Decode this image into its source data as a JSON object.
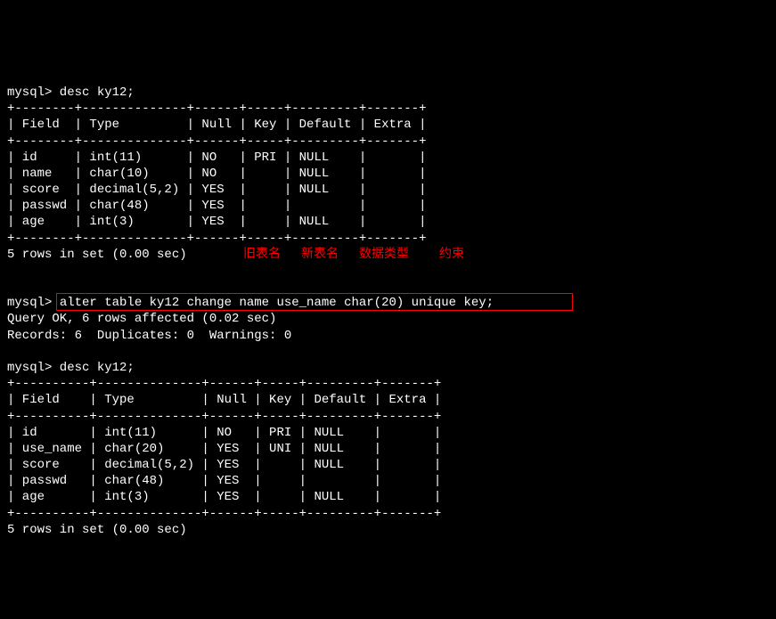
{
  "line1": "mysql> desc ky12;",
  "table1": {
    "sep": "+--------+--------------+------+-----+---------+-------+",
    "header": "| Field  | Type         | Null | Key | Default | Extra |",
    "rows": [
      "| id     | int(11)      | NO   | PRI | NULL    |       |",
      "| name   | char(10)     | NO   |     | NULL    |       |",
      "| score  | decimal(5,2) | YES  |     | NULL    |       |",
      "| passwd | char(48)     | YES  |     |         |       |",
      "| age    | int(3)       | YES  |     | NULL    |       |"
    ]
  },
  "result1": "5 rows in set (0.00 sec)",
  "annotations": {
    "a1": "旧表名",
    "a2": "新表名",
    "a3": "数据类型",
    "a4": "约束"
  },
  "alter_prompt": "mysql> ",
  "alter_cmd": "alter table ky12 change name use_name char(20) unique key;",
  "query_ok": "Query OK, 6 rows affected (0.02 sec)",
  "records": "Records: 6  Duplicates: 0  Warnings: 0",
  "line2": "mysql> desc ky12;",
  "table2": {
    "sep": "+----------+--------------+------+-----+---------+-------+",
    "header": "| Field    | Type         | Null | Key | Default | Extra |",
    "rows": [
      "| id       | int(11)      | NO   | PRI | NULL    |       |",
      "| use_name | char(20)     | YES  | UNI | NULL    |       |",
      "| score    | decimal(5,2) | YES  |     | NULL    |       |",
      "| passwd   | char(48)     | YES  |     |         |       |",
      "| age      | int(3)       | YES  |     | NULL    |       |"
    ]
  },
  "result2": "5 rows in set (0.00 sec)"
}
